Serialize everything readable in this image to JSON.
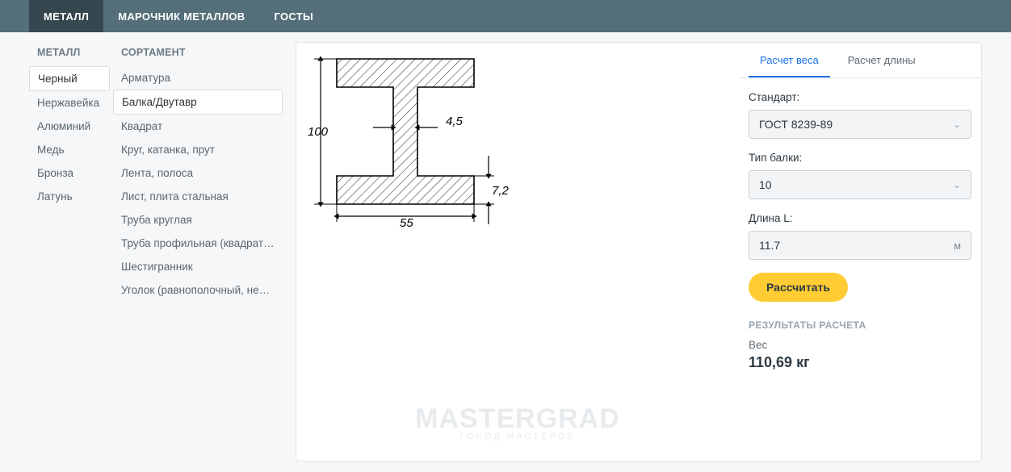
{
  "topnav": {
    "items": [
      {
        "label": "МЕТАЛЛ",
        "active": true
      },
      {
        "label": "МАРОЧНИК МЕТАЛЛОВ",
        "active": false
      },
      {
        "label": "ГОСТЫ",
        "active": false
      }
    ]
  },
  "columns": {
    "metal": {
      "header": "МЕТАЛЛ",
      "items": [
        {
          "label": "Черный",
          "active": true
        },
        {
          "label": "Нержавейка",
          "active": false
        },
        {
          "label": "Алюминий",
          "active": false
        },
        {
          "label": "Медь",
          "active": false
        },
        {
          "label": "Бронза",
          "active": false
        },
        {
          "label": "Латунь",
          "active": false
        }
      ]
    },
    "sort": {
      "header": "СОРТАМЕНТ",
      "items": [
        {
          "label": "Арматура",
          "active": false
        },
        {
          "label": "Балка/Двутавр",
          "active": true
        },
        {
          "label": "Квадрат",
          "active": false
        },
        {
          "label": "Круг, катанка, прут",
          "active": false
        },
        {
          "label": "Лента, полоса",
          "active": false
        },
        {
          "label": "Лист, плита стальная",
          "active": false
        },
        {
          "label": "Труба круглая",
          "active": false
        },
        {
          "label": "Труба профильная (квадратная /…",
          "active": false
        },
        {
          "label": "Шестигранник",
          "active": false
        },
        {
          "label": "Уголок (равнополочный, неравн…",
          "active": false
        }
      ]
    }
  },
  "diagram": {
    "height_label": "100",
    "width_label": "55",
    "web_thickness_label": "4,5",
    "flange_thickness_label": "7,2"
  },
  "watermark": {
    "title": "MASTERGRAD",
    "subtitle": "ГОРОД МАСТЕРОВ"
  },
  "form": {
    "tabs": [
      {
        "label": "Расчет веса",
        "active": true
      },
      {
        "label": "Расчет длины",
        "active": false
      }
    ],
    "standard_label": "Стандарт:",
    "standard_value": "ГОСТ 8239-89",
    "beam_type_label": "Тип балки:",
    "beam_type_value": "10",
    "length_label": "Длина L:",
    "length_value": "11.7",
    "length_unit": "м",
    "calc_button": "Рассчитать",
    "results_header": "РЕЗУЛЬТАТЫ РАСЧЕТА",
    "weight_label": "Вес",
    "weight_value": "110,69 кг"
  }
}
